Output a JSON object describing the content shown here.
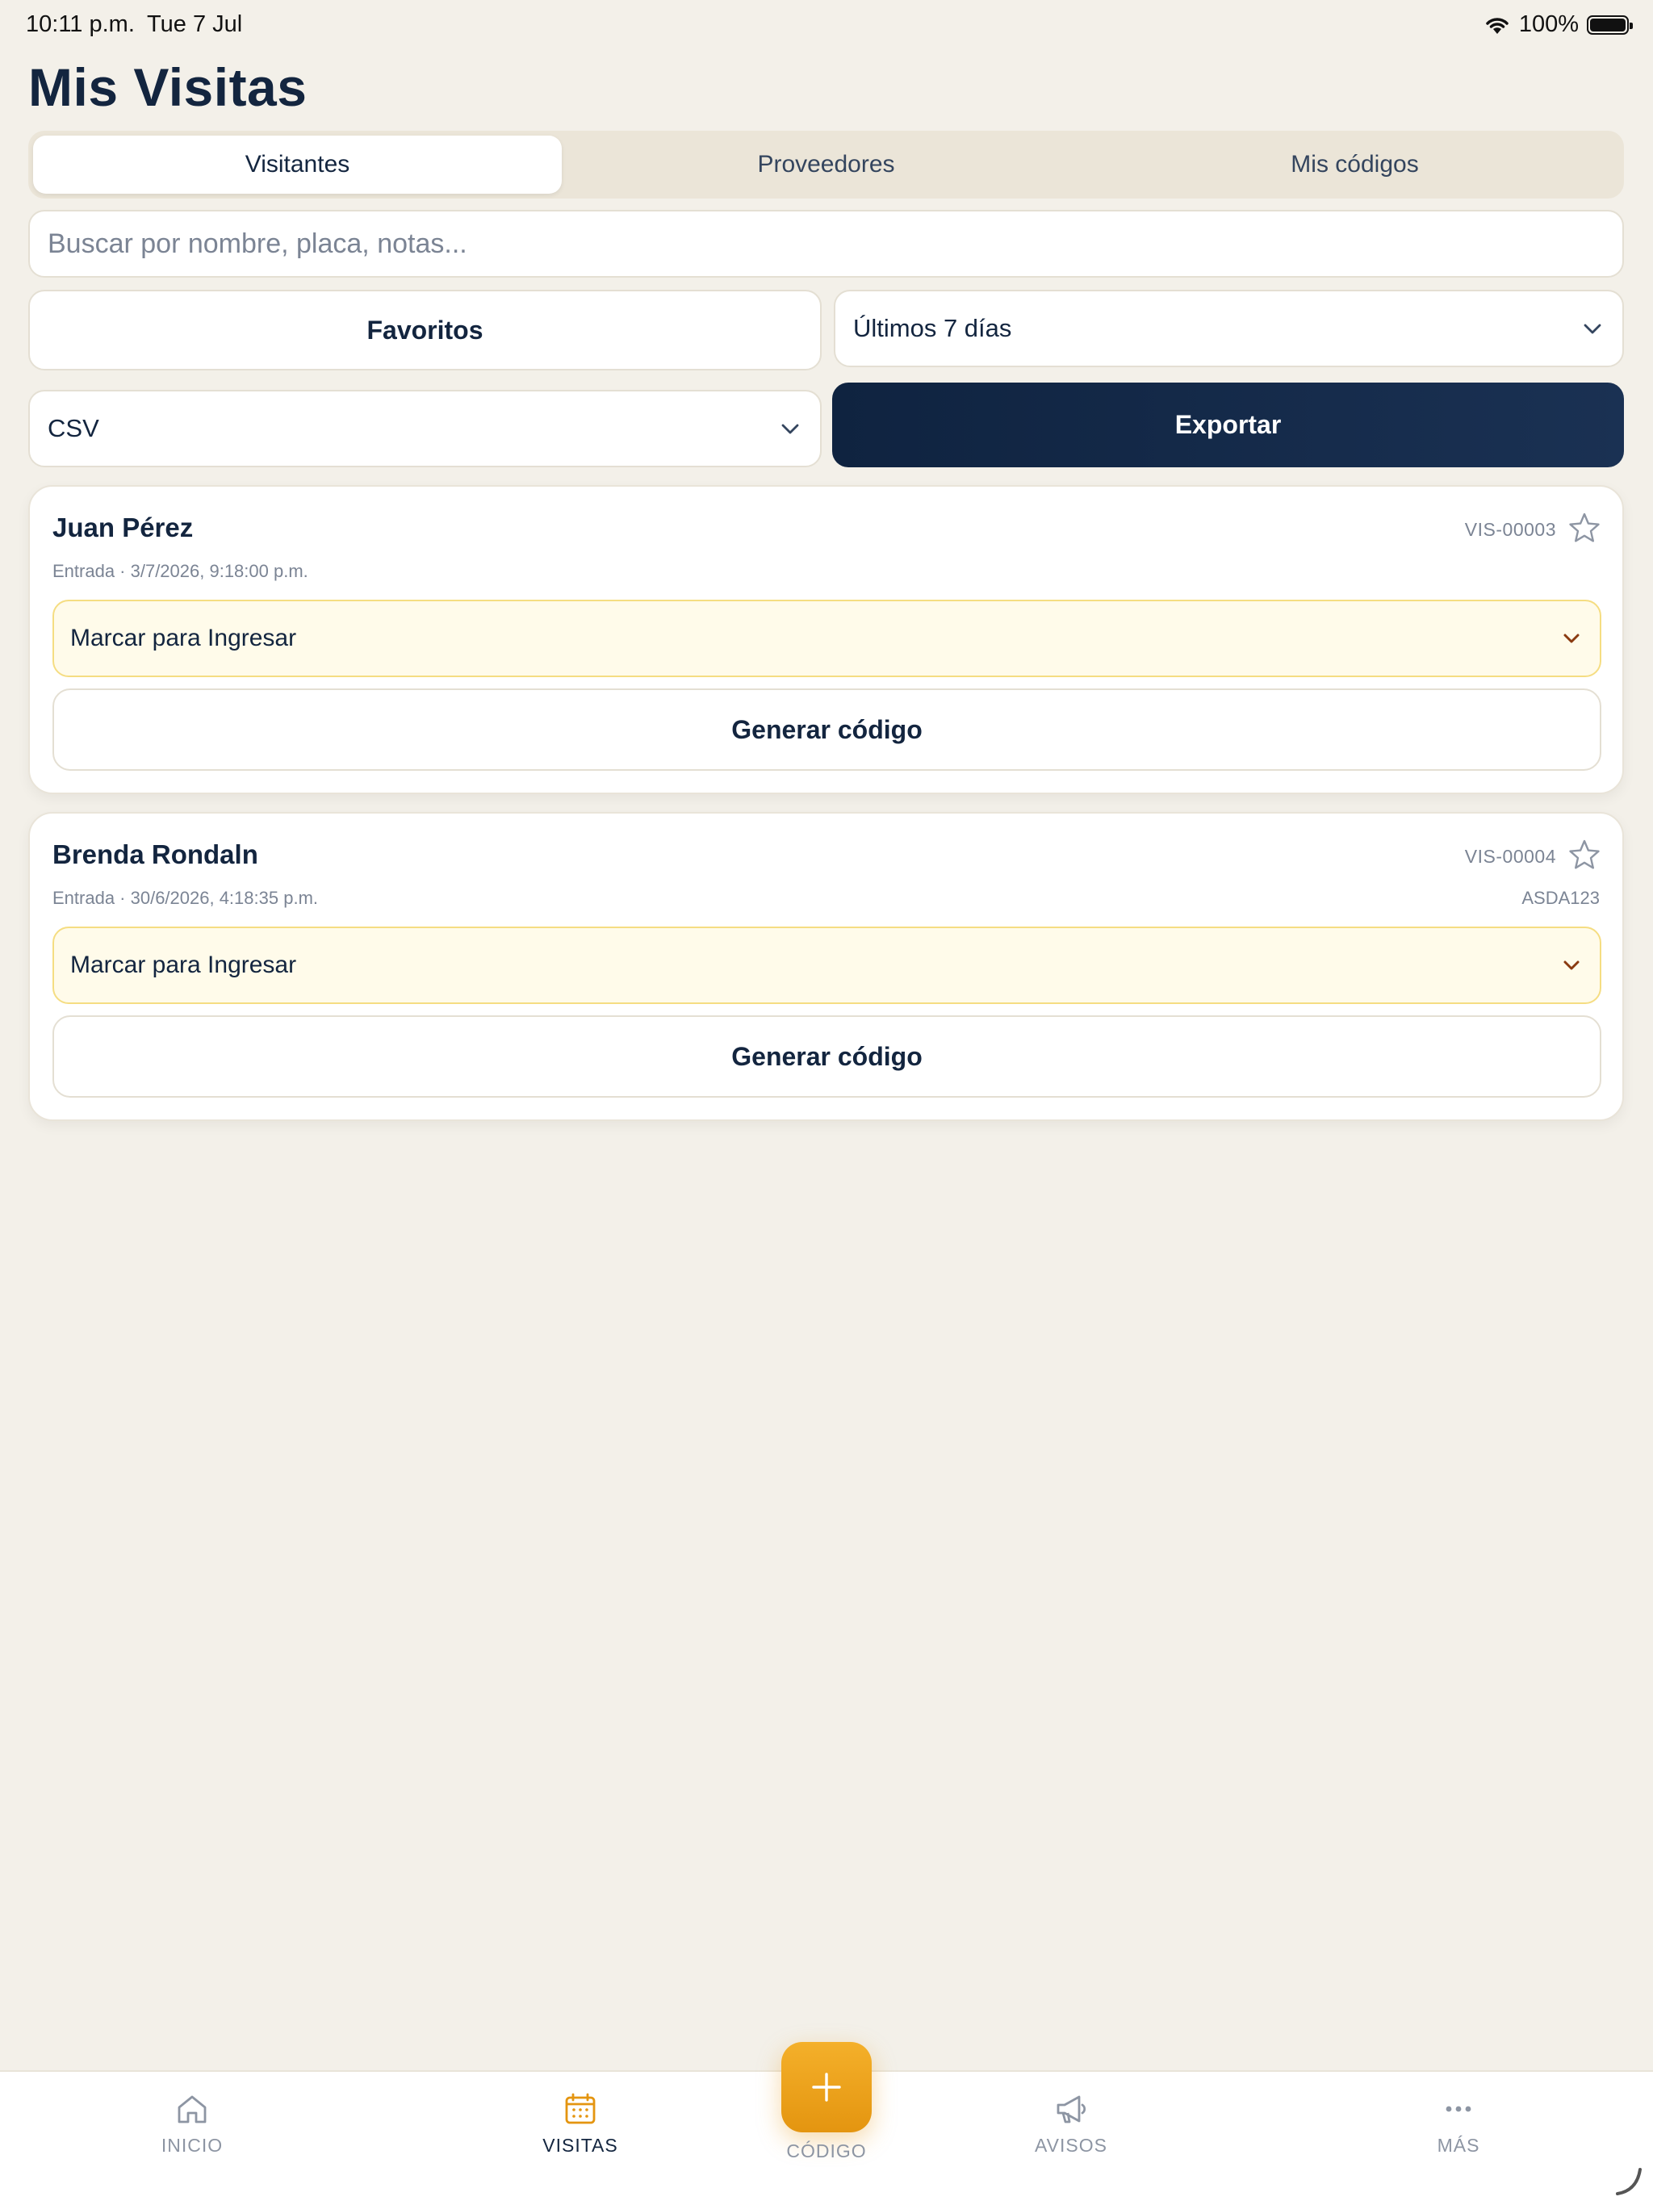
{
  "status_bar": {
    "time": "10:11 p.m.",
    "date": "Tue 7 Jul",
    "battery": "100%"
  },
  "page": {
    "title": "Mis Visitas"
  },
  "tabs": [
    {
      "label": "Visitantes",
      "active": true
    },
    {
      "label": "Proveedores",
      "active": false
    },
    {
      "label": "Mis códigos",
      "active": false
    }
  ],
  "search": {
    "placeholder": "Buscar por nombre, placa, notas..."
  },
  "filters": {
    "favorites_label": "Favoritos",
    "range_value": "Últimos 7 días",
    "format_value": "CSV",
    "export_label": "Exportar"
  },
  "visits": [
    {
      "name": "Juan Pérez",
      "id": "VIS-00003",
      "entry": "Entrada · 3/7/2026, 9:18:00 p.m.",
      "plate": "",
      "status": "Marcar para Ingresar",
      "action": "Generar código"
    },
    {
      "name": "Brenda Rondaln",
      "id": "VIS-00004",
      "entry": "Entrada · 30/6/2026, 4:18:35 p.m.",
      "plate": "ASDA123",
      "status": "Marcar para Ingresar",
      "action": "Generar código"
    }
  ],
  "nav": {
    "home": "INICIO",
    "visits": "VISITAS",
    "code": "CÓDIGO",
    "notices": "AVISOS",
    "more": "MÁS"
  },
  "colors": {
    "background": "#f3f0e9",
    "navy": "#13253f",
    "accent": "#f0a51f",
    "status_bg": "#fffbea",
    "status_border": "#f5dd82"
  }
}
